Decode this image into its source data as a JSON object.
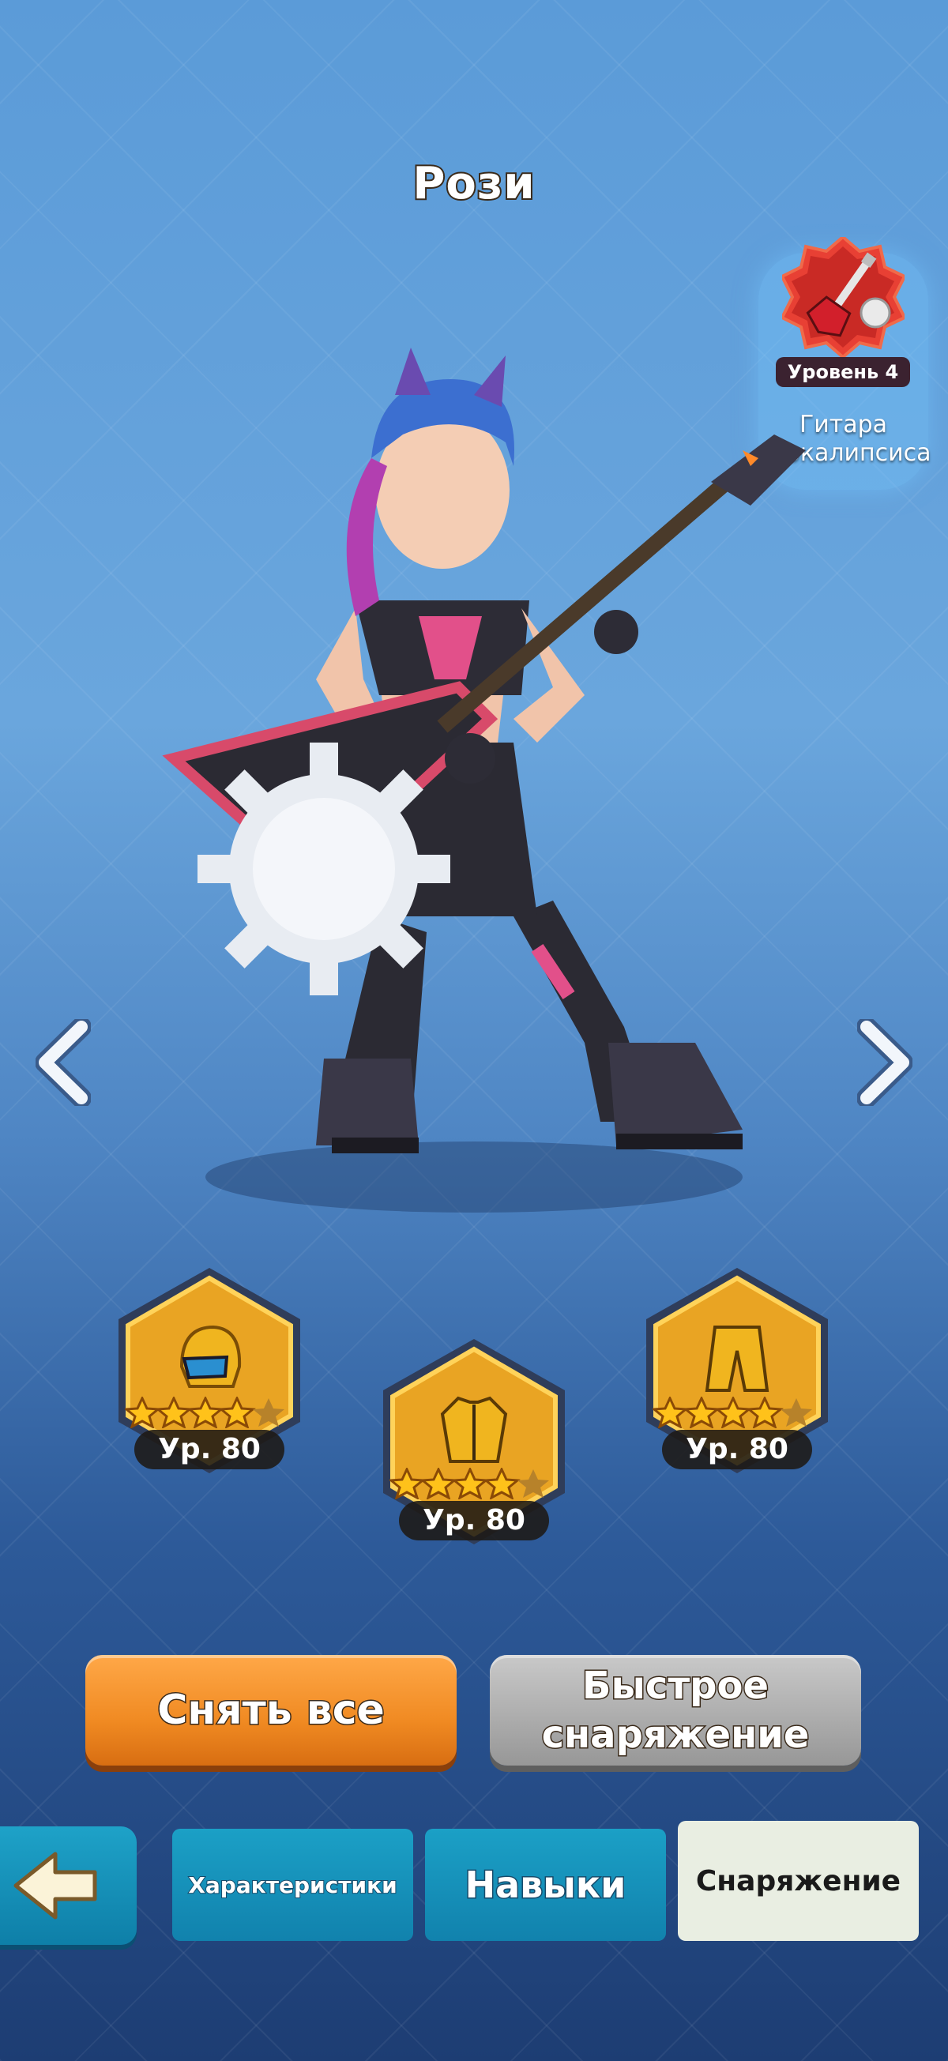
{
  "hero": {
    "name": "Рози"
  },
  "weapon": {
    "level_label": "Уровень 4",
    "name": "Гитара апокалипсиса"
  },
  "gear": [
    {
      "slot": "helmet",
      "level": "Ур. 80",
      "stars": 4,
      "max_stars": 5
    },
    {
      "slot": "jacket",
      "level": "Ур. 80",
      "stars": 4,
      "max_stars": 5
    },
    {
      "slot": "pants",
      "level": "Ур. 80",
      "stars": 4,
      "max_stars": 5
    }
  ],
  "buttons": {
    "unequip_all": "Снять все",
    "quick_equip_line1": "Быстрое",
    "quick_equip_line2": "снаряжение"
  },
  "tabs": {
    "stats": "Характеристики",
    "skills": "Навыки",
    "equipment": "Снаряжение"
  },
  "icons": [
    "back-arrow-icon",
    "chevron-left-icon",
    "chevron-right-icon",
    "guitar-icon",
    "helmet-icon",
    "jacket-icon",
    "pants-icon",
    "star-icon"
  ],
  "colors": {
    "accent_orange": "#f08a22",
    "tab_blue": "#1182ad",
    "star_gold": "#ffc21a"
  }
}
